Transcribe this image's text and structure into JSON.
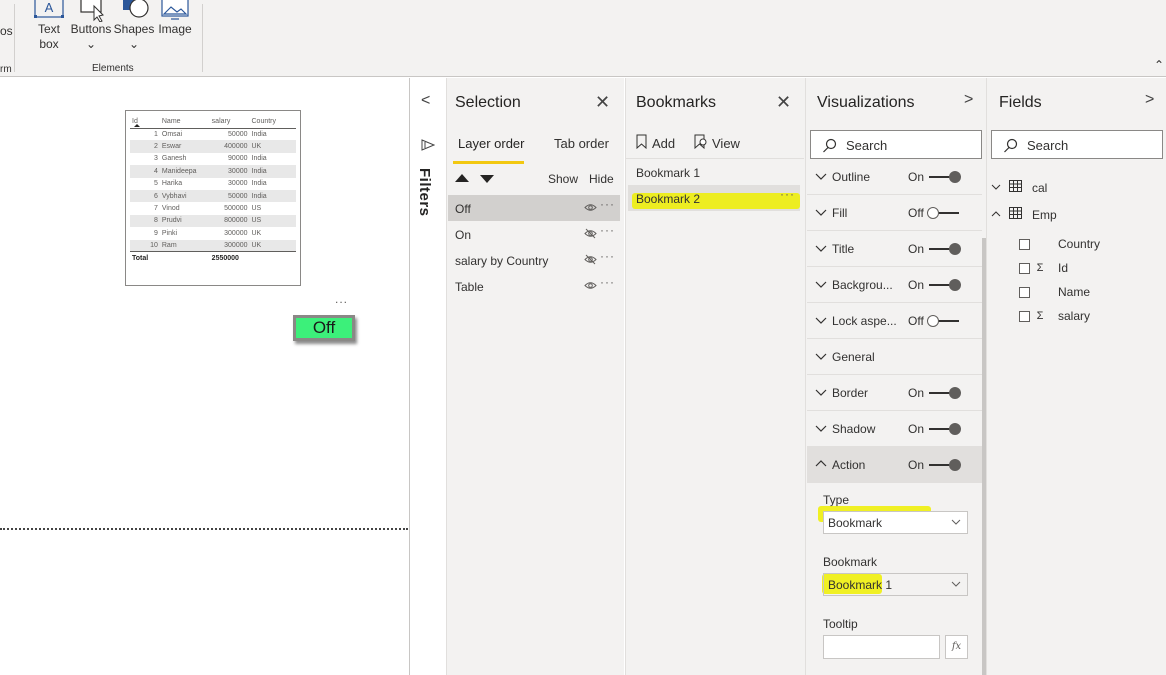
{
  "ribbon": {
    "fragment_top": "os",
    "fragment_bottom": "rm",
    "buttons": [
      {
        "line1": "Text",
        "line2": "box"
      },
      {
        "line1": "Buttons",
        "line2": "⌄"
      },
      {
        "line1": "Shapes",
        "line2": "⌄"
      },
      {
        "line1": "Image",
        "line2": ""
      }
    ],
    "textbox_glyph": "A",
    "group_label": "Elements",
    "collapse_icon": "⌃"
  },
  "canvas": {
    "table": {
      "columns": [
        "Id",
        "Name",
        "salary",
        "Country"
      ],
      "rows": [
        [
          "1",
          "Omsai",
          "50000",
          "India"
        ],
        [
          "2",
          "Eswar",
          "400000",
          "UK"
        ],
        [
          "3",
          "Ganesh",
          "90000",
          "India"
        ],
        [
          "4",
          "Manideepa",
          "30000",
          "India"
        ],
        [
          "5",
          "Harika",
          "30000",
          "India"
        ],
        [
          "6",
          "Vybhavi",
          "50000",
          "India"
        ],
        [
          "7",
          "Vinod",
          "500000",
          "US"
        ],
        [
          "8",
          "Prudvi",
          "800000",
          "US"
        ],
        [
          "9",
          "Pinki",
          "300000",
          "UK"
        ],
        [
          "10",
          "Ram",
          "300000",
          "UK"
        ]
      ],
      "total_label": "Total",
      "total_value": "2550000"
    },
    "button_more": "...",
    "button_label": "Off",
    "button_color": "#3cf07a"
  },
  "filters": {
    "label": "Filters",
    "collapse_icon": "<"
  },
  "selection": {
    "title": "Selection",
    "close": "✕",
    "tabs": [
      "Layer order",
      "Tab order"
    ],
    "show_label": "Show",
    "hide_label": "Hide",
    "layers": [
      {
        "name": "Off",
        "dots": "···"
      },
      {
        "name": "On",
        "dots": "···"
      },
      {
        "name": "salary by Country",
        "dots": "···"
      },
      {
        "name": "Table",
        "dots": "···"
      }
    ]
  },
  "bookmarks": {
    "title": "Bookmarks",
    "close": "✕",
    "add_label": "Add",
    "view_label": "View",
    "items": [
      {
        "name": "Bookmark 1",
        "dots": ""
      },
      {
        "name": "Bookmark 2",
        "dots": "···"
      }
    ]
  },
  "visualizations": {
    "title": "Visualizations",
    "chevron": ">",
    "search_placeholder": "Search",
    "sections": [
      {
        "label": "Outline",
        "state": "On"
      },
      {
        "label": "Fill",
        "state": "Off"
      },
      {
        "label": "Title",
        "state": "On"
      },
      {
        "label": "Backgrou...",
        "state": "On"
      },
      {
        "label": "Lock aspe...",
        "state": "Off"
      },
      {
        "label": "General",
        "state": ""
      },
      {
        "label": "Border",
        "state": "On"
      },
      {
        "label": "Shadow",
        "state": "On"
      },
      {
        "label": "Action",
        "state": "On"
      }
    ],
    "action": {
      "type_label": "Type",
      "type_value": "Bookmark",
      "bookmark_label": "Bookmark",
      "bookmark_value": "Bookmark 1",
      "tooltip_label": "Tooltip",
      "fx_label": "fx"
    }
  },
  "fields": {
    "title": "Fields",
    "chevron": ">",
    "search_placeholder": "Search",
    "tables": [
      {
        "name": "cal",
        "expanded": false
      },
      {
        "name": "Emp",
        "expanded": true
      }
    ],
    "emp_fields": [
      {
        "name": "Country",
        "sigma": ""
      },
      {
        "name": "Id",
        "sigma": "Σ"
      },
      {
        "name": "Name",
        "sigma": ""
      },
      {
        "name": "salary",
        "sigma": "Σ"
      }
    ]
  },
  "highlight_color": "#eef000"
}
